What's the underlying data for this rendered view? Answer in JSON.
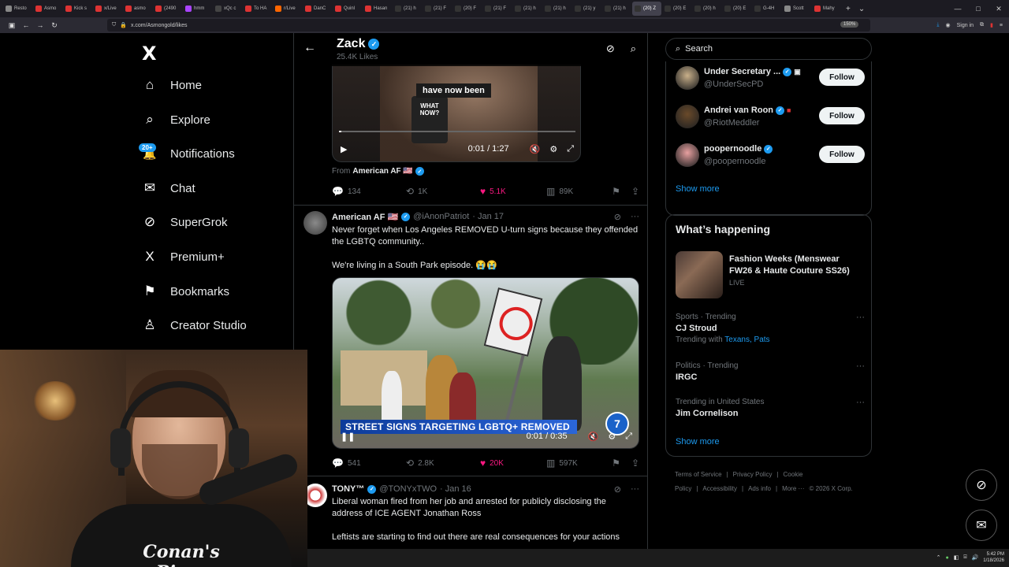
{
  "browser": {
    "url": "x.com/Asmongold/likes",
    "zoom": "150%",
    "tabs": [
      {
        "label": "Resto",
        "color": "#888"
      },
      {
        "label": "Asmo",
        "color": "#d33"
      },
      {
        "label": "Kick s",
        "color": "#d33"
      },
      {
        "label": "x/Live",
        "color": "#d33"
      },
      {
        "label": "asmo",
        "color": "#d33"
      },
      {
        "label": "(2490",
        "color": "#d33"
      },
      {
        "label": "hmm",
        "color": "#a4f"
      },
      {
        "label": "xQc c",
        "color": "#444"
      },
      {
        "label": "To HA",
        "color": "#d33"
      },
      {
        "label": "r/Live",
        "color": "#f60"
      },
      {
        "label": "DanC",
        "color": "#d33"
      },
      {
        "label": "Quinl",
        "color": "#d33"
      },
      {
        "label": "Hasan",
        "color": "#d33"
      },
      {
        "label": "(21) h",
        "color": "#333"
      },
      {
        "label": "(21) F",
        "color": "#333"
      },
      {
        "label": "(20) F",
        "color": "#333"
      },
      {
        "label": "(21) F",
        "color": "#333"
      },
      {
        "label": "(21) h",
        "color": "#333"
      },
      {
        "label": "(21) h",
        "color": "#333"
      },
      {
        "label": "(21) y",
        "color": "#333"
      },
      {
        "label": "(21) h",
        "color": "#333"
      },
      {
        "label": "(20) Z",
        "color": "#333",
        "active": true
      },
      {
        "label": "(20) E",
        "color": "#333"
      },
      {
        "label": "(20) h",
        "color": "#333"
      },
      {
        "label": "(20) E",
        "color": "#333"
      },
      {
        "label": "G-4H",
        "color": "#333"
      },
      {
        "label": "Scott",
        "color": "#888"
      },
      {
        "label": "Mahy",
        "color": "#d33"
      }
    ],
    "sign_in": "Sign in",
    "time": "5:42 PM",
    "date": "1/18/2026"
  },
  "nav": {
    "logo": "X",
    "items": [
      {
        "label": "Home",
        "icon": "⌂"
      },
      {
        "label": "Explore",
        "icon": "⌕"
      },
      {
        "label": "Notifications",
        "icon": "🔔"
      },
      {
        "label": "Chat",
        "icon": "✉"
      },
      {
        "label": "SuperGrok",
        "icon": "⊘"
      },
      {
        "label": "Premium+",
        "icon": "X"
      },
      {
        "label": "Bookmarks",
        "icon": "⚑"
      },
      {
        "label": "Creator Studio",
        "icon": "♙"
      }
    ],
    "notif_badge": "20+"
  },
  "webcam": {
    "shirt_text": "Conan's Pizza"
  },
  "header": {
    "name": "Zack",
    "likes": "25.4K Likes"
  },
  "tweet1": {
    "caption": "have now been",
    "mic_text": "WHAT NOW?",
    "time": "0:01 / 1:27",
    "progress": 0.01,
    "from_label": "From",
    "from_name": "American AF 🇺🇸",
    "replies": "134",
    "reposts": "1K",
    "likes": "5.1K",
    "views": "89K"
  },
  "tweet2": {
    "name": "American AF 🇺🇸",
    "handle": "@iAnonPatriot",
    "date": "· Jan 17",
    "text1": "Never forget when Los Angeles REMOVED U-turn signs because they offended the LGBTQ community..",
    "text2": "We're living in a South Park episode. 😭😭",
    "lower_third": "STREET SIGNS TARGETING LGBTQ+ REMOVED",
    "channel": "7",
    "time": "0:01 / 0:35",
    "replies": "541",
    "reposts": "2.8K",
    "likes": "20K",
    "views": "597K"
  },
  "tweet3": {
    "name": "TONY™",
    "handle": "@TONYxTWO",
    "date": "· Jan 16",
    "text1": "Liberal woman fired from her job and arrested for publicly disclosing the address of ICE AGENT Jonathan Ross",
    "text2": "Leftists are starting to find out there are real consequences for your actions"
  },
  "right": {
    "search_placeholder": "Search",
    "who": [
      {
        "name": "Under Secretary ...",
        "handle": "@UnderSecPD",
        "follow": "Follow",
        "color": "#c9b08a"
      },
      {
        "name": "Andrei van Roon",
        "handle": "@RiotMeddler",
        "follow": "Follow",
        "color": "#6a4a2a"
      },
      {
        "name": "poopernoodle",
        "handle": "@poopernoodle",
        "follow": "Follow",
        "color": "#e8a0a0"
      }
    ],
    "show_more": "Show more",
    "happening_title": "What’s happening",
    "feature_title": "Fashion Weeks (Menswear FW26 & Haute Couture SS26)",
    "feature_status": "LIVE",
    "trends": [
      {
        "category": "Sports · Trending",
        "title": "CJ Stroud",
        "with_label": "Trending with",
        "with_links": "Texans, Pats"
      },
      {
        "category": "Politics · Trending",
        "title": "IRGC"
      },
      {
        "category": "Trending in United States",
        "title": "Jim Cornelison"
      }
    ],
    "show_more2": "Show more",
    "footer": [
      "Terms of Service",
      "|",
      "Privacy Policy",
      "|",
      "Cookie Policy",
      "|",
      "Accessibility",
      "|",
      "Ads info",
      "|",
      "More ···",
      "© 2026 X Corp."
    ]
  }
}
